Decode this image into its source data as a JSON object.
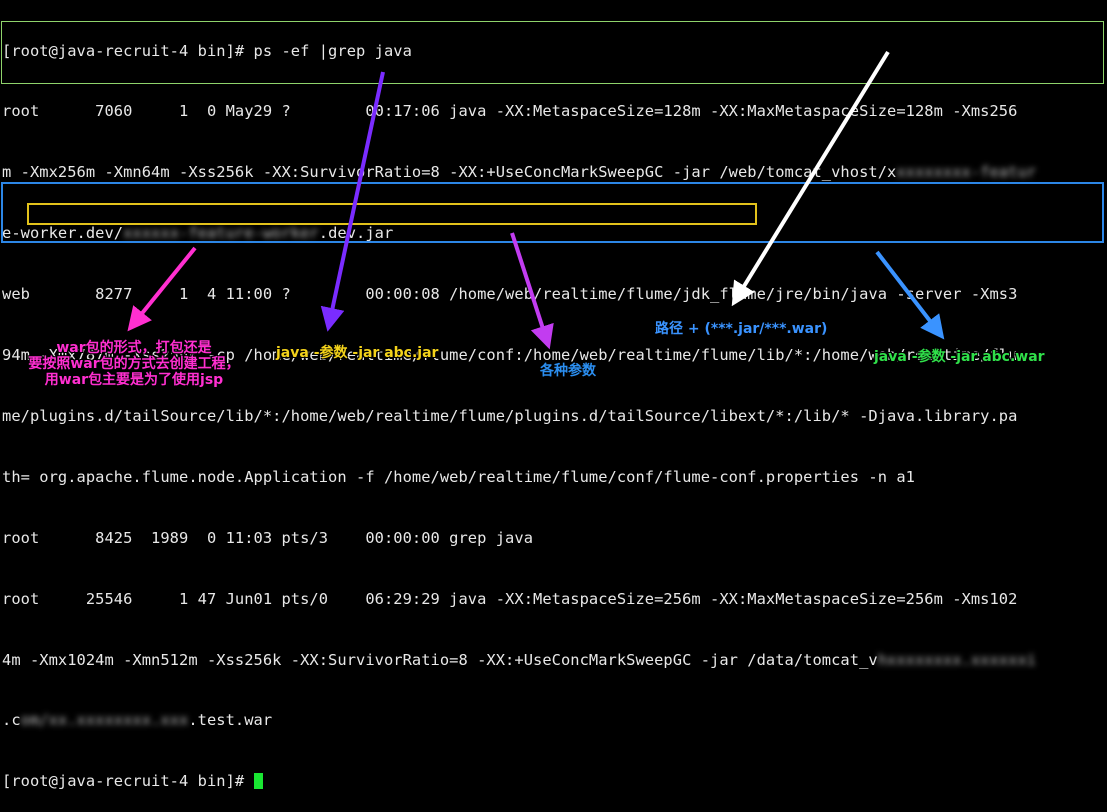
{
  "terminal": {
    "lines": [
      "[root@java-recruit-4 bin]# ps -ef |grep java",
      "root      7060     1  0 May29 ?        00:17:06 java -XX:MetaspaceSize=128m -XX:MaxMetaspaceSize=128m -Xms256",
      "m -Xmx256m -Xmn64m -Xss256k -XX:SurvivorRatio=8 -XX:+UseConcMarkSweepGC -jar /web/tomcat_vhost/x",
      "e-worker.dev/",
      "web       8277     1  4 11:00 ?        00:00:08 /home/web/realtime/flume/jdk_flume/jre/bin/java -server -Xms3",
      "94m -Xmx787m -Xss256k -cp /home/web/realtime/flume/conf:/home/web/realtime/flume/lib/*:/home/web/realtime/flu",
      "me/plugins.d/tailSource/lib/*:/home/web/realtime/flume/plugins.d/tailSource/libext/*:/lib/* -Djava.library.pa",
      "th= org.apache.flume.node.Application -f /home/web/realtime/flume/conf/flume-conf.properties -n a1",
      "root      8425  1989  0 11:03 pts/3    00:00:00 grep java",
      "root     25546     1 47 Jun01 pts/0    06:29:29 java -XX:MetaspaceSize=256m -XX:MaxMetaspaceSize=256m -Xms102",
      "4m -Xmx1024m -Xmn512m -Xss256k -XX:SurvivorRatio=8 -XX:+UseConcMarkSweepGC -jar /data/tomcat_v",
      ".c",
      "[root@java-recruit-4 bin]# "
    ],
    "redacted": {
      "line2_tail": "xxxxxxxx-featur",
      "line3_tail": "xxxxxx-feature-worker",
      "line3_suffix": ".dev.jar",
      "line10_tail": "hxxxxxxxx.xxxxxxi",
      "line11_tail": "om/xx.xxxxxxxx.xxx",
      "line11_suffix": ".test.war"
    }
  },
  "annotations": {
    "war_note_line1": "war包的形式，打包还是",
    "war_note_line2": "要按照war包的方式去创建工程，",
    "war_note_line3": "用war包主要是为了使用jsp",
    "jar_cmd": "java -参数 -jar abc.jar",
    "params": "各种参数",
    "path": "路径 + (***.jar/***.war)",
    "war_cmd": "java -参数 -jar abc.war"
  },
  "colors": {
    "background": "#000000",
    "text": "#e8e8e8",
    "cursor": "#19e632",
    "box_green": "#8fd36b",
    "box_blue": "#2c86e6",
    "box_yellow": "#e2c21b",
    "arrow_magenta": "#ff2fd0",
    "arrow_purple": "#7a2cff",
    "arrow_violet": "#c23cf0",
    "arrow_white": "#ffffff",
    "arrow_blue": "#3a93ff"
  }
}
